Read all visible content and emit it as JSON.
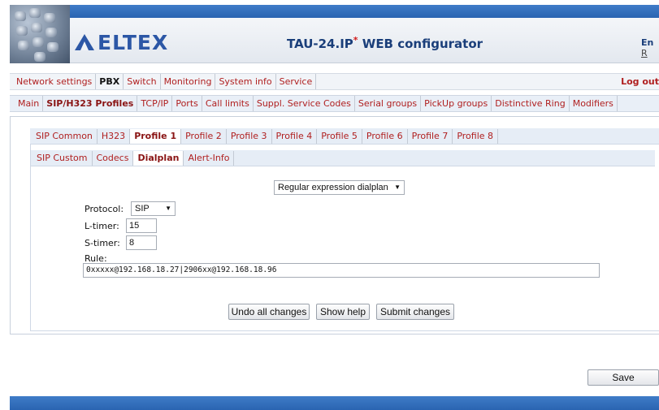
{
  "header": {
    "logo_text": "ELTEX",
    "title": "TAU-24.IP",
    "title_mark": "*",
    "title_suffix": " WEB configurator",
    "lang_en": "En",
    "lang_ru": "R"
  },
  "main_menu": {
    "items": [
      "Network settings",
      "PBX",
      "Switch",
      "Monitoring",
      "System info",
      "Service"
    ],
    "active": "PBX",
    "logout": "Log out"
  },
  "sub_menu": {
    "items": [
      "Main",
      "SIP/H323 Profiles",
      "TCP/IP",
      "Ports",
      "Call limits",
      "Suppl. Service Codes",
      "Serial groups",
      "PickUp groups",
      "Distinctive Ring",
      "Modifiers"
    ],
    "active": "SIP/H323 Profiles"
  },
  "profile_tabs": {
    "items": [
      "SIP Common",
      "H323",
      "Profile 1",
      "Profile 2",
      "Profile 3",
      "Profile 4",
      "Profile 5",
      "Profile 6",
      "Profile 7",
      "Profile 8"
    ],
    "active": "Profile 1"
  },
  "profile_subtabs": {
    "items": [
      "SIP Custom",
      "Codecs",
      "Dialplan",
      "Alert-Info"
    ],
    "active": "Dialplan"
  },
  "form": {
    "dialplan_mode": "Regular expression dialplan",
    "protocol_label": "Protocol:",
    "protocol_value": "SIP",
    "l_timer_label": "L-timer:",
    "l_timer_value": "15",
    "s_timer_label": "S-timer:",
    "s_timer_value": "8",
    "rule_label": "Rule:",
    "rule_value": "0xxxxx@192.168.18.27|2906xx@192.168.18.96"
  },
  "buttons": {
    "undo": "Undo all changes",
    "help": "Show help",
    "submit": "Submit changes",
    "save": "Save"
  },
  "colors": {
    "link_red": "#b01f1f",
    "header_blue": "#2a64b1",
    "logo_blue": "#2c57a6"
  }
}
